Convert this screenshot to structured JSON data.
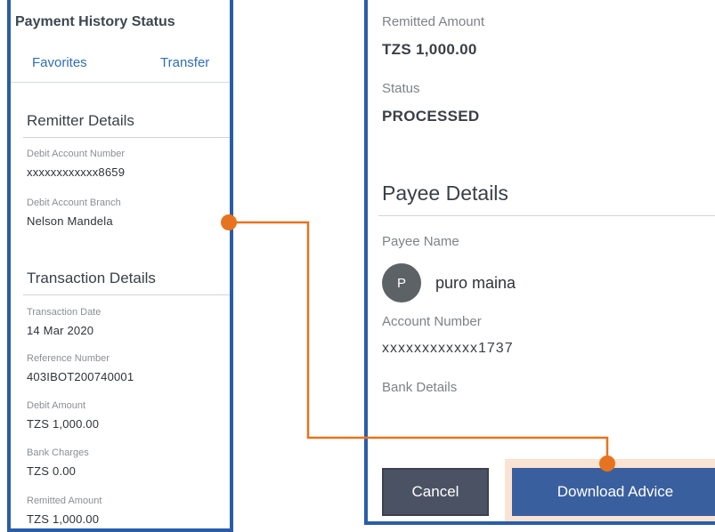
{
  "left_panel": {
    "title": "Payment History Status",
    "tabs": [
      {
        "label": "Favorites"
      },
      {
        "label": "Transfer"
      }
    ],
    "remitter_section": {
      "heading": "Remitter Details",
      "fields": [
        {
          "label": "Debit Account Number",
          "value": "xxxxxxxxxxxx8659"
        },
        {
          "label": "Debit Account Branch",
          "value": "Nelson Mandela"
        }
      ]
    },
    "transaction_section": {
      "heading": "Transaction Details",
      "fields": [
        {
          "label": "Transaction Date",
          "value": "14 Mar 2020"
        },
        {
          "label": "Reference Number",
          "value": "403IBOT200740001"
        },
        {
          "label": "Debit Amount",
          "value": "TZS 1,000.00"
        },
        {
          "label": "Bank Charges",
          "value": "TZS 0.00"
        },
        {
          "label": "Remitted Amount",
          "value": "TZS 1,000.00"
        }
      ]
    }
  },
  "right_panel": {
    "remitted_amount": {
      "label": "Remitted Amount",
      "value": "TZS 1,000.00"
    },
    "status": {
      "label": "Status",
      "value": "PROCESSED"
    },
    "payee_section": {
      "heading": "Payee Details",
      "payee_name_label": "Payee Name",
      "avatar_initial": "P",
      "payee_name": "puro maina",
      "account_number_label": "Account Number",
      "account_number": "xxxxxxxxxxxx1737",
      "bank_details_label": "Bank Details"
    },
    "buttons": {
      "cancel_label": "Cancel",
      "download_label": "Download Advice"
    }
  },
  "colors": {
    "frame_blue": "#2a5da8",
    "tab_blue": "#2f6db5",
    "connector_orange": "#e8731e",
    "cancel_button": "#4b5263",
    "download_button": "#3a5f9e",
    "avatar_gray": "#5d6266"
  }
}
